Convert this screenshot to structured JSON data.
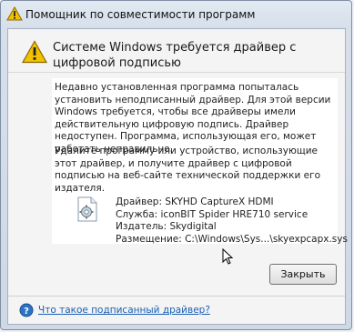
{
  "window": {
    "title": "Помощник по совместимости программ",
    "title_icon": "warning-icon"
  },
  "header": {
    "icon": "warning-icon",
    "message": "Системе Windows требуется драйвер с цифровой подписью"
  },
  "body": {
    "paragraph1": "Недавно установленная программа попыталась установить неподписанный драйвер. Для этой версии Windows требуется, чтобы все драйверы имели действительную цифровую подпись. Драйвер недоступен. Программа, использующая его, может работать неправильно.",
    "paragraph2": "Удалите программу или устройство, использующие этот драйвер, и получите драйвер с цифровой подписью на веб-сайте технической поддержки его издателя."
  },
  "driver": {
    "icon": "driver-file-icon",
    "name_line": "Драйвер: SKYHD CaptureX HDMI",
    "service_line": "Служба: iconBIT Spider HRE710 service",
    "publisher_line": "Издатель: Skydigital",
    "location_line": "Размещение: C:\\Windows\\Sys...\\skyexpcapx.sys"
  },
  "buttons": {
    "close_label": "Закрыть"
  },
  "footer": {
    "icon": "help-icon",
    "link_text": "Что такое подписанный драйвер?"
  },
  "colors": {
    "link": "#1a5fb4",
    "warning": "#f2c200",
    "help": "#2a73c8"
  }
}
